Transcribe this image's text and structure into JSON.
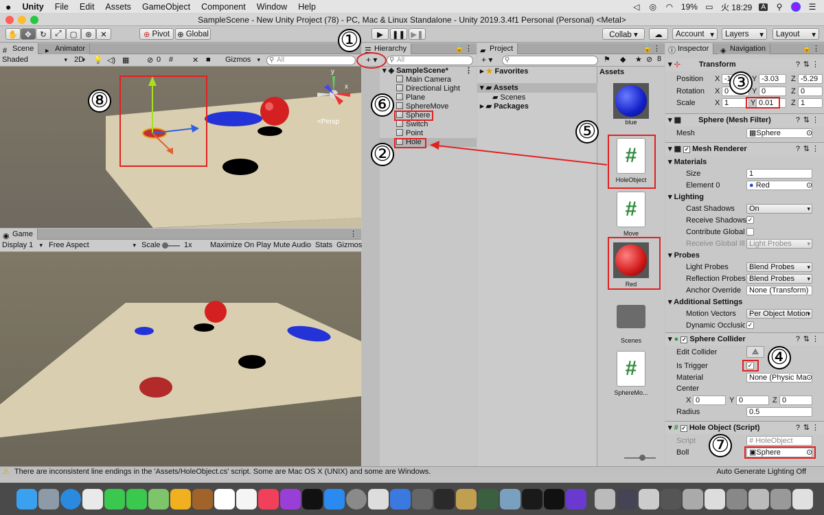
{
  "menubar": {
    "app": "Unity",
    "items": [
      "File",
      "Edit",
      "Assets",
      "GameObject",
      "Component",
      "Window",
      "Help"
    ],
    "battery": "19%",
    "time": "火 18:29",
    "input": "A"
  },
  "window": {
    "title": "SampleScene - New Unity Project (78) - PC, Mac & Linux Standalone - Unity 2019.3.4f1 Personal (Personal) <Metal>"
  },
  "toolbar": {
    "pivot": "Pivot",
    "global": "Global",
    "collab": "Collab ▾",
    "account": "Account",
    "layers": "Layers",
    "layout": "Layout"
  },
  "scene": {
    "tab": "Scene",
    "tab2": "Animator",
    "shading": "Shaded",
    "mode2d": "2D",
    "hidden": "0",
    "gizmos": "Gizmos",
    "search": "All",
    "persp": "<Persp",
    "axis_y": "y",
    "axis_x": "x"
  },
  "game": {
    "tab": "Game",
    "display": "Display 1",
    "aspect": "Free Aspect",
    "scale_label": "Scale",
    "scale_val": "1x",
    "maximize": "Maximize On Play",
    "mute": "Mute Audio",
    "stats": "Stats",
    "gizmos": "Gizmos"
  },
  "hierarchy": {
    "tab": "Hierarchy",
    "search": "All",
    "add": "+ ▾",
    "scene": "SampleScene*",
    "items": [
      "Main Camera",
      "Directional Light",
      "Plane",
      "SphereMove",
      "Sphere",
      "Switch",
      "Point",
      "Hole"
    ]
  },
  "project": {
    "tab": "Project",
    "favorites": "Favorites",
    "assets": "Assets",
    "scenes": "Scenes",
    "packages": "Packages",
    "header": "Assets",
    "count": "8",
    "files": [
      "blue",
      "HoleObject",
      "Move",
      "Red",
      "Scenes",
      "SphereMo..."
    ]
  },
  "inspector": {
    "tab": "Inspector",
    "tab2": "Navigation",
    "transform": {
      "title": "Transform",
      "position": {
        "label": "Position",
        "x": "-1.09",
        "y": "-3.03",
        "z": "-5.29"
      },
      "rotation": {
        "label": "Rotation",
        "x": "0",
        "y": "0",
        "z": "0"
      },
      "scale": {
        "label": "Scale",
        "x": "1",
        "y": "0.01",
        "z": "1"
      }
    },
    "meshfilter": {
      "title": "Sphere (Mesh Filter)",
      "mesh_label": "Mesh",
      "mesh": "Sphere"
    },
    "renderer": {
      "title": "Mesh Renderer",
      "materials": "Materials",
      "size_label": "Size",
      "size": "1",
      "el0_label": "Element 0",
      "el0": "Red",
      "lighting": "Lighting",
      "cast_label": "Cast Shadows",
      "cast": "On",
      "recv_label": "Receive Shadows",
      "contrib_label": "Contribute Global I",
      "recvgi_label": "Receive Global Illu",
      "recvgi": "Light Probes",
      "probes": "Probes",
      "lp_label": "Light Probes",
      "lp": "Blend Probes",
      "rp_label": "Reflection Probes",
      "rp": "Blend Probes",
      "anchor_label": "Anchor Override",
      "anchor": "None (Transform)",
      "additional": "Additional Settings",
      "mv_label": "Motion Vectors",
      "mv": "Per Object Motion",
      "dyn_label": "Dynamic Occlusio"
    },
    "collider": {
      "title": "Sphere Collider",
      "edit_label": "Edit Collider",
      "trigger_label": "Is Trigger",
      "mat_label": "Material",
      "mat": "None (Physic Ma",
      "center_label": "Center",
      "cx": "0",
      "cy": "0",
      "cz": "0",
      "radius_label": "Radius",
      "radius": "0.5"
    },
    "script": {
      "title": "Hole Object (Script)",
      "script_label": "Script",
      "script": "HoleObject",
      "boll_label": "Boll",
      "boll": "Sphere"
    }
  },
  "status": {
    "message": "There are inconsistent line endings in the 'Assets/HoleObject.cs' script. Some are Mac OS X (UNIX) and some are Windows.",
    "right": "Auto Generate Lighting Off"
  },
  "annotations": [
    "①",
    "②",
    "③",
    "④",
    "⑤",
    "⑥",
    "⑦",
    "⑧"
  ],
  "colors": {
    "annotation": "#e22020",
    "floor": "#d9cfb0",
    "sky": "#7d7566"
  }
}
